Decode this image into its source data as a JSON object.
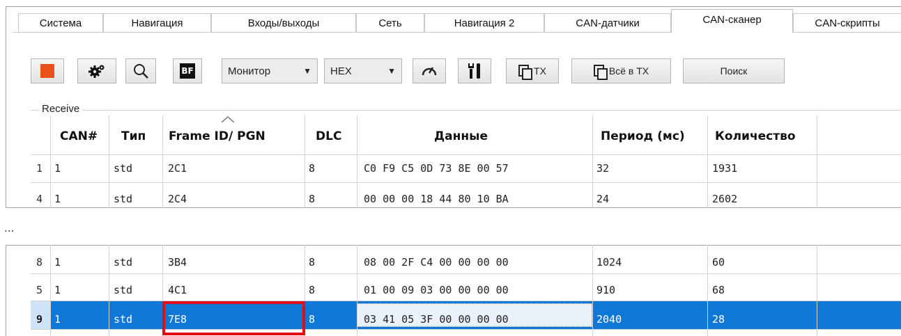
{
  "tabs": [
    "Система",
    "Навигация",
    "Входы/выходы",
    "Сеть",
    "Навигация 2",
    "CAN-датчики",
    "CAN-сканер",
    "CAN-скрипты"
  ],
  "active_tab": "CAN-сканер",
  "toolbar": {
    "mode_combo": "Монитор",
    "format_combo": "HEX",
    "tx_label": "TX",
    "all_tx_label": "Всё в TX",
    "search_label": "Поиск",
    "bf_label": "BF",
    "stop_color": "#e8511a"
  },
  "group_label": "Receive",
  "columns": {
    "can": "CAN#",
    "type": "Тип",
    "frame_id": "Frame ID/ PGN",
    "dlc": "DLC",
    "data": "Данные",
    "period": "Период (мс)",
    "count": "Количество"
  },
  "rows_top": [
    {
      "num": "1",
      "can": "1",
      "type": "std",
      "id": "2C1",
      "dlc": "8",
      "data": "C0 F9 C5 0D 73 8E 00 57",
      "period": "32",
      "count": "1931"
    },
    {
      "num": "4",
      "can": "1",
      "type": "std",
      "id": "2C4",
      "dlc": "8",
      "data": "00 00 00 18 44 80 10 BA",
      "period": "24",
      "count": "2602"
    }
  ],
  "ellipsis": "...",
  "rows_bottom": [
    {
      "num": "8",
      "can": "1",
      "type": "std",
      "id": "3B4",
      "dlc": "8",
      "data": "08 00 2F C4 00 00 00 00",
      "period": "1024",
      "count": "60"
    },
    {
      "num": "5",
      "can": "1",
      "type": "std",
      "id": "4C1",
      "dlc": "8",
      "data": "01 00 09 03 00 00 00 00",
      "period": "910",
      "count": "68"
    },
    {
      "num": "9",
      "can": "1",
      "type": "std",
      "id": "7E8",
      "dlc": "8",
      "data": "03 41 05 3F 00 00 00 00",
      "period": "2040",
      "count": "28"
    }
  ],
  "colors": {
    "selection": "#0f78d7",
    "highlight_box": "#e30d14"
  }
}
